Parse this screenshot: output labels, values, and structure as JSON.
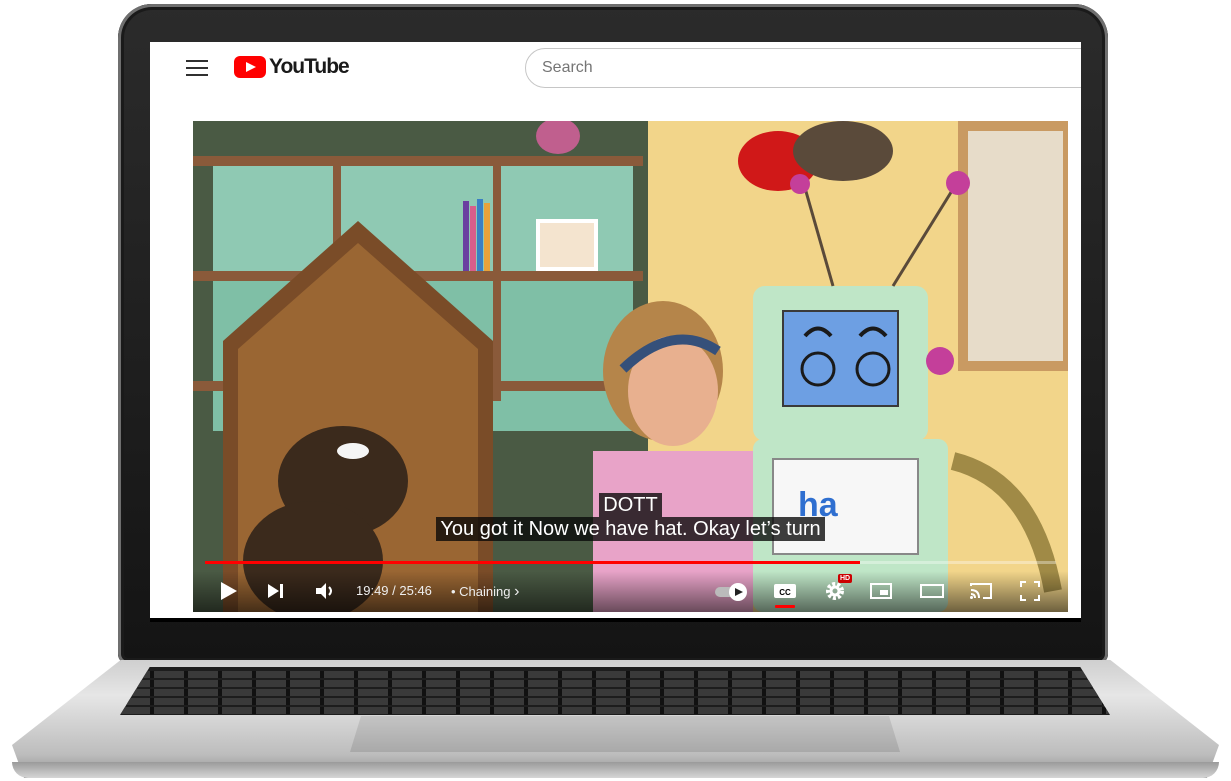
{
  "header": {
    "logo_text": "YouTube",
    "search_placeholder": "Search"
  },
  "player": {
    "caption_speaker": "DOTT",
    "caption_text": "You got it Now we have hat. Okay let’s turn",
    "time_display": "19:49 / 25:46",
    "chapter_label": "• Chaining",
    "chapter_chevron": "›",
    "progress_fraction": 0.77,
    "cc_active": true,
    "autoplay_on": true,
    "quality_badge": "HD",
    "whiteboard_text": "ha"
  },
  "colors": {
    "brand_red": "#ff0000",
    "progress_red": "#ff0000",
    "header_bg": "#ffffff"
  },
  "icons": {
    "menu": "menu-icon",
    "play": "play-icon",
    "next": "next-icon",
    "volume": "volume-icon",
    "autoplay": "autoplay-toggle-icon",
    "cc": "cc-icon",
    "settings": "gear-icon",
    "miniplayer": "miniplayer-icon",
    "theater": "theater-mode-icon",
    "cast": "cast-icon",
    "fullscreen": "fullscreen-icon"
  }
}
